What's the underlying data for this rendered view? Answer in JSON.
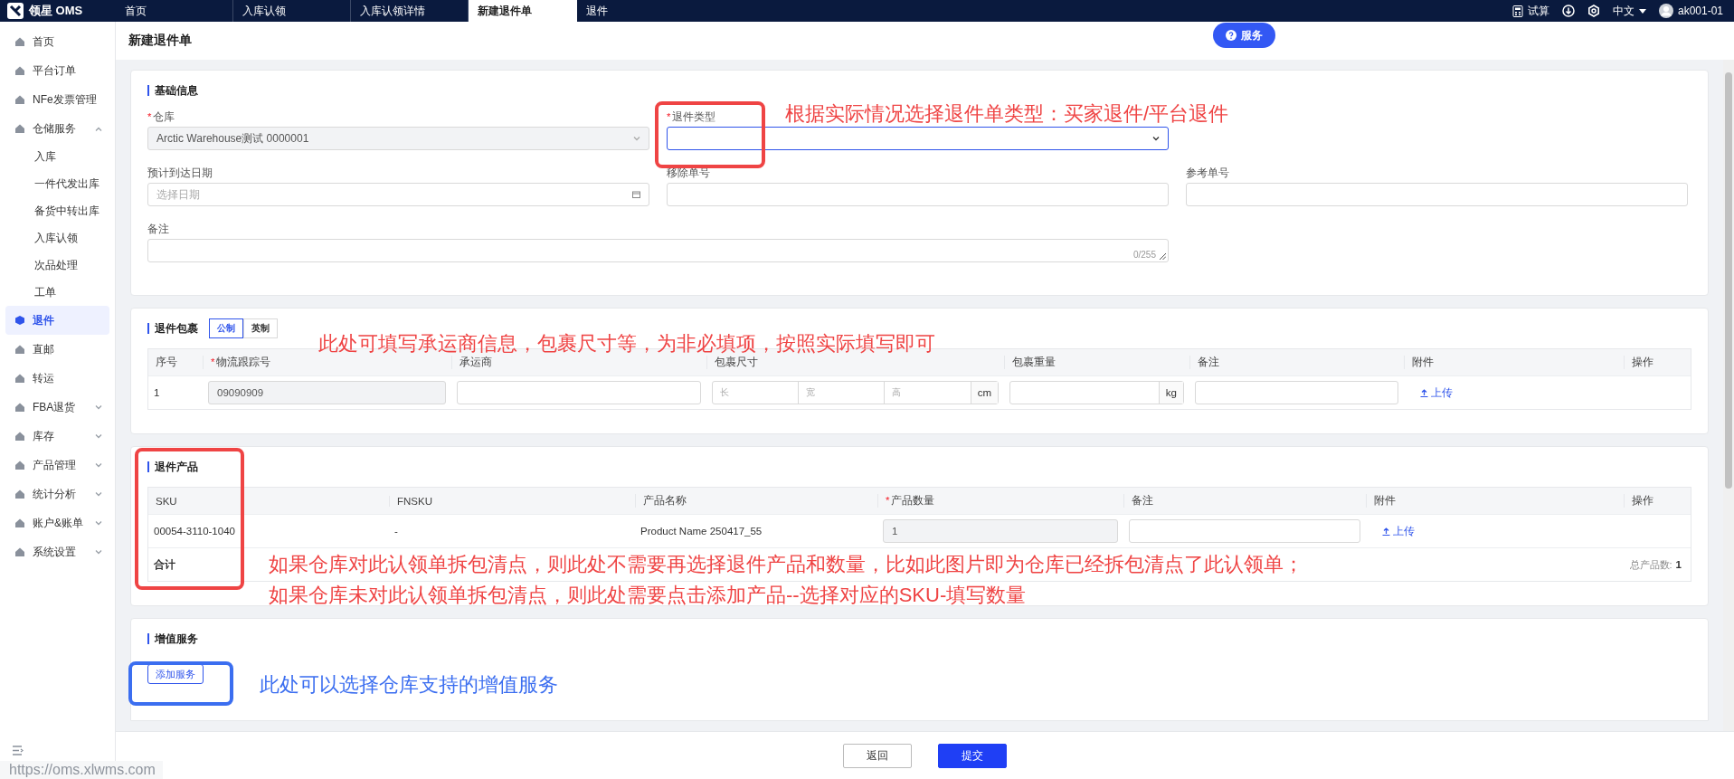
{
  "topbar": {
    "logo": "领星 OMS",
    "tabs": [
      {
        "label": "首页",
        "selected": false
      },
      {
        "label": "入库认领",
        "selected": false
      },
      {
        "label": "入库认领详情",
        "selected": false
      },
      {
        "label": "新建退件单",
        "selected": true
      },
      {
        "label": "退件",
        "selected": false
      }
    ],
    "calc": "试算",
    "language": "中文",
    "user": "ak001-01"
  },
  "sidebar": {
    "items": [
      {
        "label": "首页",
        "selected": false
      },
      {
        "label": "平台订单",
        "selected": false
      },
      {
        "label": "NFe发票管理",
        "selected": false
      },
      {
        "label": "仓储服务",
        "selected": false,
        "expanded": true,
        "children": [
          {
            "label": "入库",
            "selected": false
          },
          {
            "label": "一件代发出库",
            "selected": false
          },
          {
            "label": "备货中转出库",
            "selected": false
          },
          {
            "label": "入库认领",
            "selected": false
          },
          {
            "label": "次品处理",
            "selected": false
          },
          {
            "label": "工单",
            "selected": false
          }
        ]
      },
      {
        "label": "退件",
        "selected": true
      },
      {
        "label": "直邮",
        "selected": false
      },
      {
        "label": "转运",
        "selected": false
      },
      {
        "label": "FBA退货",
        "selected": false,
        "expanded": false
      },
      {
        "label": "库存",
        "selected": false,
        "expanded": false
      },
      {
        "label": "产品管理",
        "selected": false,
        "expanded": false
      },
      {
        "label": "统计分析",
        "selected": false,
        "expanded": false
      },
      {
        "label": "账户&账单",
        "selected": false,
        "expanded": false
      },
      {
        "label": "系统设置",
        "selected": false,
        "expanded": false
      }
    ],
    "status_url": "https://oms.xlwms.com"
  },
  "page": {
    "title": "新建退件单",
    "service_button": "服务"
  },
  "basic": {
    "title": "基础信息",
    "fields": [
      {
        "label": "仓库",
        "required_mark": "*",
        "kind": "select",
        "value": "Arctic Warehouse测试 0000001",
        "disabled": true,
        "focused": false
      },
      {
        "label": "退件类型",
        "required_mark": "*",
        "kind": "select",
        "disabled": false,
        "focused": true
      },
      {
        "label": "预计到达日期",
        "kind": "date",
        "placeholder": "选择日期",
        "disabled": false,
        "focused": false
      },
      {
        "label": "移除单号",
        "kind": "text",
        "disabled": false,
        "focused": false
      },
      {
        "label": "参考单号",
        "kind": "text",
        "disabled": false,
        "focused": false
      },
      {
        "label": "备注",
        "kind": "textarea",
        "counter": "0/255",
        "disabled": false,
        "focused": false
      }
    ]
  },
  "package": {
    "title": "退件包裹",
    "units": [
      {
        "label": "公制",
        "selected": true
      },
      {
        "label": "英制",
        "selected": false
      }
    ],
    "columns": [
      {
        "label": "序号"
      },
      {
        "label": "物流跟踪号",
        "required_mark": "*"
      },
      {
        "label": "承运商"
      },
      {
        "label": "包裹尺寸"
      },
      {
        "label": "包裹重量"
      },
      {
        "label": "备注"
      },
      {
        "label": "附件"
      },
      {
        "label": "操作"
      }
    ],
    "rows": [
      {
        "index": "1",
        "tracking": "09090909",
        "dims": [
          "长",
          "宽",
          "高"
        ],
        "dim_unit": "cm",
        "weight_unit": "kg",
        "upload": "上传"
      }
    ]
  },
  "products": {
    "title": "退件产品",
    "columns": [
      {
        "label": "SKU"
      },
      {
        "label": "FNSKU"
      },
      {
        "label": "产品名称"
      },
      {
        "label": "产品数量",
        "required_mark": "*"
      },
      {
        "label": "备注"
      },
      {
        "label": "附件"
      },
      {
        "label": "操作"
      }
    ],
    "rows": [
      {
        "sku": "00054-3110-1040",
        "fnsku": "-",
        "name": "Product Name 250417_55",
        "quantity": "1",
        "upload": "上传"
      }
    ],
    "total": {
      "label": "合计",
      "count_label": "总产品数:",
      "count": "1"
    }
  },
  "services": {
    "title": "增值服务",
    "add_button": "添加服务"
  },
  "footer": {
    "buttons": [
      {
        "label": "返回",
        "kind": "secondary"
      },
      {
        "label": "提交",
        "kind": "primary"
      }
    ]
  },
  "annotations": [
    {
      "kind": "box",
      "color": "#ef4444"
    },
    {
      "kind": "note",
      "color": "#ef4444",
      "text": "根据实际情况选择退件单类型：买家退件/平台退件"
    },
    {
      "kind": "note",
      "color": "#ef4444",
      "text": "此处可填写承运商信息，包裹尺寸等，为非必填项，按照实际填写即可"
    },
    {
      "kind": "box",
      "color": "#ef4444"
    },
    {
      "kind": "note",
      "color": "#ef4444",
      "text": "如果仓库对此认领单拆包清点，则此处不需要再选择退件产品和数量，比如此图片即为仓库已经拆包清点了此认领单；"
    },
    {
      "kind": "note",
      "color": "#ef4444",
      "text": "如果仓库未对此认领单拆包清点，则此处需要点击添加产品--选择对应的SKU-填写数量"
    },
    {
      "kind": "box",
      "color": "#3b6ef0"
    },
    {
      "kind": "note",
      "color": "#3b6ef0",
      "text": "此处可以选择仓库支持的增值服务"
    }
  ]
}
